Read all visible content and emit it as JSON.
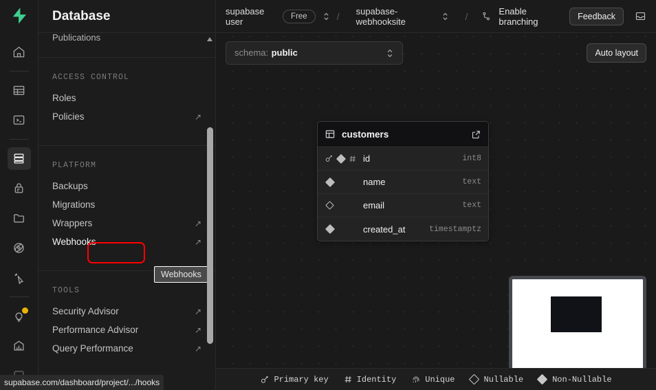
{
  "window": {
    "status_url": "supabase.com/dashboard/project/.../hooks"
  },
  "rail": {
    "logo": "supabase-logo",
    "items": [
      {
        "name": "home-icon",
        "label": "Home"
      },
      {
        "name": "table-editor-icon",
        "label": "Table Editor"
      },
      {
        "name": "sql-editor-icon",
        "label": "SQL Editor"
      },
      {
        "name": "database-icon",
        "label": "Database"
      },
      {
        "name": "authentication-icon",
        "label": "Authentication"
      },
      {
        "name": "storage-icon",
        "label": "Storage"
      },
      {
        "name": "edge-functions-icon",
        "label": "Edge Functions"
      },
      {
        "name": "realtime-icon",
        "label": "Realtime"
      },
      {
        "name": "advisors-icon",
        "label": "Advisors"
      },
      {
        "name": "reports-icon",
        "label": "Reports"
      }
    ]
  },
  "sidebar": {
    "title": "Database",
    "cut_item": "Publications",
    "sections": [
      {
        "heading": "ACCESS CONTROL",
        "items": [
          {
            "label": "Roles",
            "external": ""
          },
          {
            "label": "Policies",
            "external": "↗"
          }
        ]
      },
      {
        "heading": "PLATFORM",
        "items": [
          {
            "label": "Backups",
            "external": ""
          },
          {
            "label": "Migrations",
            "external": ""
          },
          {
            "label": "Wrappers",
            "external": "↗"
          },
          {
            "label": "Webhooks",
            "external": "↗"
          }
        ]
      },
      {
        "heading": "TOOLS",
        "items": [
          {
            "label": "Security Advisor",
            "external": "↗"
          },
          {
            "label": "Performance Advisor",
            "external": "↗"
          },
          {
            "label": "Query Performance",
            "external": "↗"
          }
        ]
      }
    ],
    "tooltip": "Webhooks",
    "highlight_color": "#ff0000"
  },
  "topbar": {
    "org": "supabase user",
    "plan_badge": "Free",
    "project": "supabase-webhooksite",
    "separator": "/",
    "branching_label": "Enable branching",
    "feedback_label": "Feedback",
    "inbox_icon": "inbox-icon"
  },
  "toolbar": {
    "schema_label": "schema:",
    "schema_value": "public",
    "auto_layout_label": "Auto layout"
  },
  "canvas": {
    "table": {
      "name": "customers",
      "columns": [
        {
          "name": "id",
          "type": "int8",
          "primary": true,
          "identity": true,
          "nullable": false
        },
        {
          "name": "name",
          "type": "text",
          "primary": false,
          "identity": false,
          "nullable": false
        },
        {
          "name": "email",
          "type": "text",
          "primary": false,
          "identity": false,
          "nullable": true
        },
        {
          "name": "created_at",
          "type": "timestamptz",
          "primary": false,
          "identity": false,
          "nullable": false
        }
      ]
    }
  },
  "legend": {
    "items": [
      {
        "icon": "primary-key-icon",
        "label": "Primary key"
      },
      {
        "icon": "identity-icon",
        "label": "Identity"
      },
      {
        "icon": "unique-icon",
        "label": "Unique"
      },
      {
        "icon": "nullable-icon",
        "label": "Nullable"
      },
      {
        "icon": "non-nullable-icon",
        "label": "Non-Nullable"
      }
    ]
  }
}
